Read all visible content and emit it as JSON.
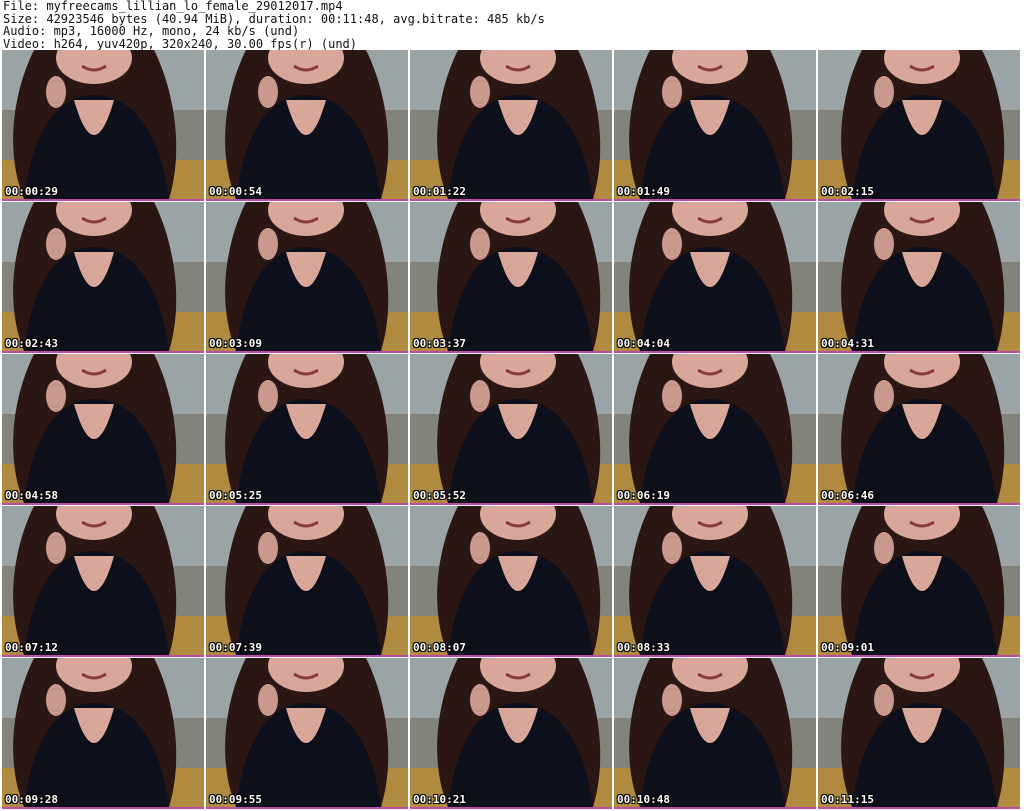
{
  "header": {
    "file_line": "File: myfreecams_lillian_lo_female_29012017.mp4",
    "size_line": "Size: 42923546 bytes (40.94 MiB), duration: 00:11:48, avg.bitrate: 485 kb/s",
    "audio_line": "Audio: mp3, 16000 Hz, mono, 24 kb/s (und)",
    "video_line": "Video: h264, yuv420p, 320x240, 30.00 fps(r) (und)"
  },
  "colors": {
    "separator": "#c04aa8",
    "wall": "#9aa3a6",
    "clothing": "#0d0f1a",
    "hair": "#2a1713",
    "skin": "#d9a79a",
    "floor": "#b08a3e"
  },
  "thumbnails": [
    {
      "timestamp": "00:00:29"
    },
    {
      "timestamp": "00:00:54"
    },
    {
      "timestamp": "00:01:22"
    },
    {
      "timestamp": "00:01:49"
    },
    {
      "timestamp": "00:02:15"
    },
    {
      "timestamp": "00:02:43"
    },
    {
      "timestamp": "00:03:09"
    },
    {
      "timestamp": "00:03:37"
    },
    {
      "timestamp": "00:04:04"
    },
    {
      "timestamp": "00:04:31"
    },
    {
      "timestamp": "00:04:58"
    },
    {
      "timestamp": "00:05:25"
    },
    {
      "timestamp": "00:05:52"
    },
    {
      "timestamp": "00:06:19"
    },
    {
      "timestamp": "00:06:46"
    },
    {
      "timestamp": "00:07:12"
    },
    {
      "timestamp": "00:07:39"
    },
    {
      "timestamp": "00:08:07"
    },
    {
      "timestamp": "00:08:33"
    },
    {
      "timestamp": "00:09:01"
    },
    {
      "timestamp": "00:09:28"
    },
    {
      "timestamp": "00:09:55"
    },
    {
      "timestamp": "00:10:21"
    },
    {
      "timestamp": "00:10:48"
    },
    {
      "timestamp": "00:11:15"
    }
  ]
}
